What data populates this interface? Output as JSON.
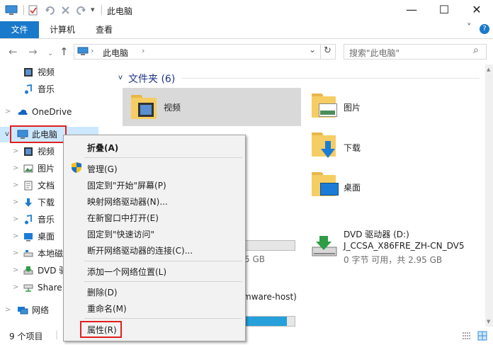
{
  "window": {
    "title": "此电脑",
    "controls": {
      "minimize": "—",
      "maximize": "☐",
      "close": "✕"
    }
  },
  "quick_access": {
    "dropdown": "▾"
  },
  "ribbon": {
    "tabs": [
      "文件",
      "计算机",
      "查看"
    ],
    "collapse_icon": "˅",
    "help_icon": "?"
  },
  "address": {
    "path": [
      "此电脑"
    ],
    "separator": "›",
    "dropdown": "⌄",
    "refresh": "↻"
  },
  "search": {
    "placeholder": "搜索\"此电脑\"",
    "icon": "⌕"
  },
  "nav_pane": {
    "items": [
      {
        "label": "视频",
        "icon": "video-icon"
      },
      {
        "label": "音乐",
        "icon": "music-icon"
      },
      {
        "label": "OneDrive",
        "icon": "onedrive-icon"
      },
      {
        "label": "此电脑",
        "icon": "computer-icon"
      },
      {
        "label": "视频",
        "icon": "video-icon"
      },
      {
        "label": "图片",
        "icon": "pictures-icon"
      },
      {
        "label": "文档",
        "icon": "documents-icon"
      },
      {
        "label": "下载",
        "icon": "downloads-icon"
      },
      {
        "label": "音乐",
        "icon": "music-icon"
      },
      {
        "label": "桌面",
        "icon": "desktop-icon"
      },
      {
        "label": "本地磁",
        "icon": "drive-icon"
      },
      {
        "label": "DVD 驱",
        "icon": "dvd-icon"
      },
      {
        "label": "Share",
        "icon": "network-drive-icon"
      },
      {
        "label": "网络",
        "icon": "network-icon"
      }
    ]
  },
  "content": {
    "folders_header": "文件夹 (6)",
    "folders": [
      {
        "label": "视频",
        "icon": "video-folder-icon",
        "selected": true
      },
      {
        "label": "图片",
        "icon": "pictures-folder-icon"
      },
      {
        "label": "下载",
        "icon": "downloads-folder-icon"
      },
      {
        "label": "桌面",
        "icon": "desktop-folder-icon"
      }
    ],
    "drives": [
      {
        "partial_free": "5 GB",
        "fill_fraction": 0.0
      },
      {
        "name": "DVD 驱动器 (D:)",
        "volume": "J_CCSA_X86FRE_ZH-CN_DV5",
        "free": "0 字节 可用，共 2.95 GB",
        "icon": "dvd-drive-icon"
      },
      {
        "partial_name": "mware-host)",
        "fill_fraction": 0.85
      }
    ]
  },
  "status": {
    "item_count": "9 个项目"
  },
  "context_menu": {
    "items": [
      {
        "label": "折叠(A)",
        "bold": true
      },
      {
        "label": "管理(G)",
        "shield": true
      },
      {
        "label": "固定到\"开始\"屏幕(P)"
      },
      {
        "label": "映射网络驱动器(N)..."
      },
      {
        "label": "在新窗口中打开(E)"
      },
      {
        "label": "固定到\"快速访问\""
      },
      {
        "label": "断开网络驱动器的连接(C)..."
      },
      {
        "label": "添加一个网络位置(L)"
      },
      {
        "label": "删除(D)"
      },
      {
        "label": "重命名(M)"
      },
      {
        "label": "属性(R)",
        "highlighted_box": true
      }
    ]
  },
  "colors": {
    "accent": "#1979ca",
    "selection": "#cce8ff",
    "annotation_red": "#e02020",
    "group_header": "#1e3287",
    "progress_fill": "#26a0da"
  }
}
